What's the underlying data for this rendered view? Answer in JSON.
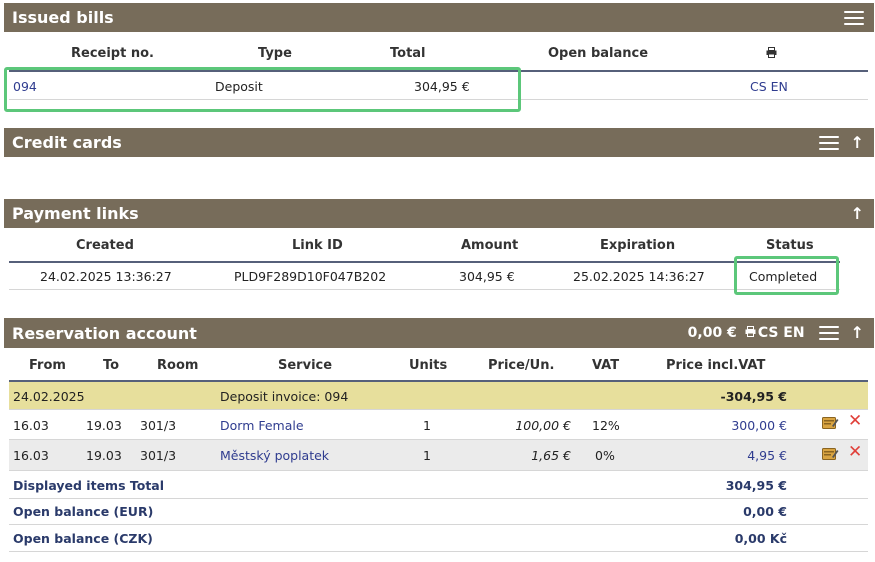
{
  "issued": {
    "title": "Issued bills",
    "cols": {
      "receipt": "Receipt no.",
      "type": "Type",
      "total": "Total",
      "open": "Open balance"
    },
    "row": {
      "receipt": "094",
      "type": "Deposit",
      "total": "304,95 €",
      "lang": "CS EN"
    }
  },
  "cards": {
    "title": "Credit cards"
  },
  "links": {
    "title": "Payment links",
    "cols": {
      "created": "Created",
      "link_id": "Link ID",
      "amount": "Amount",
      "expiration": "Expiration",
      "status": "Status"
    },
    "row": {
      "created": "24.02.2025 13:36:27",
      "link_id": "PLD9F289D10F047B202",
      "amount": "304,95 €",
      "expiration": "25.02.2025 14:36:27",
      "status": "Completed"
    }
  },
  "account": {
    "title": "Reservation account",
    "balance": "0,00 €",
    "lang": "CS EN",
    "cols": {
      "from": "From",
      "to": "To",
      "room": "Room",
      "service": "Service",
      "units": "Units",
      "price": "Price/Un.",
      "vat": "VAT",
      "incl": "Price incl.VAT"
    },
    "deposit": {
      "date": "24.02.2025",
      "label": "Deposit invoice: 094",
      "amount": "-304,95 €"
    },
    "items": [
      {
        "from": "16.03",
        "to": "19.03",
        "room": "301/3",
        "service": "Dorm Female",
        "units": "1",
        "price": "100,00 €",
        "vat": "12%",
        "incl": "300,00 €"
      },
      {
        "from": "16.03",
        "to": "19.03",
        "room": "301/3",
        "service": "Městský poplatek",
        "units": "1",
        "price": "1,65 €",
        "vat": "0%",
        "incl": "4,95 €"
      }
    ],
    "totals": [
      {
        "label": "Displayed items Total",
        "value": "304,95 €"
      },
      {
        "label": "Open balance (EUR)",
        "value": "0,00 €"
      },
      {
        "label": "Open balance (CZK)",
        "value": "0,00 Kč"
      }
    ]
  },
  "colors": {
    "header_bar": "#776c5a",
    "highlight": "#5cc77a",
    "deposit_row": "#e7df9c",
    "link": "#2f3c8f"
  },
  "icons": [
    "menu-icon",
    "arrow-up-icon",
    "printer-icon",
    "edit-icon",
    "delete-icon"
  ]
}
